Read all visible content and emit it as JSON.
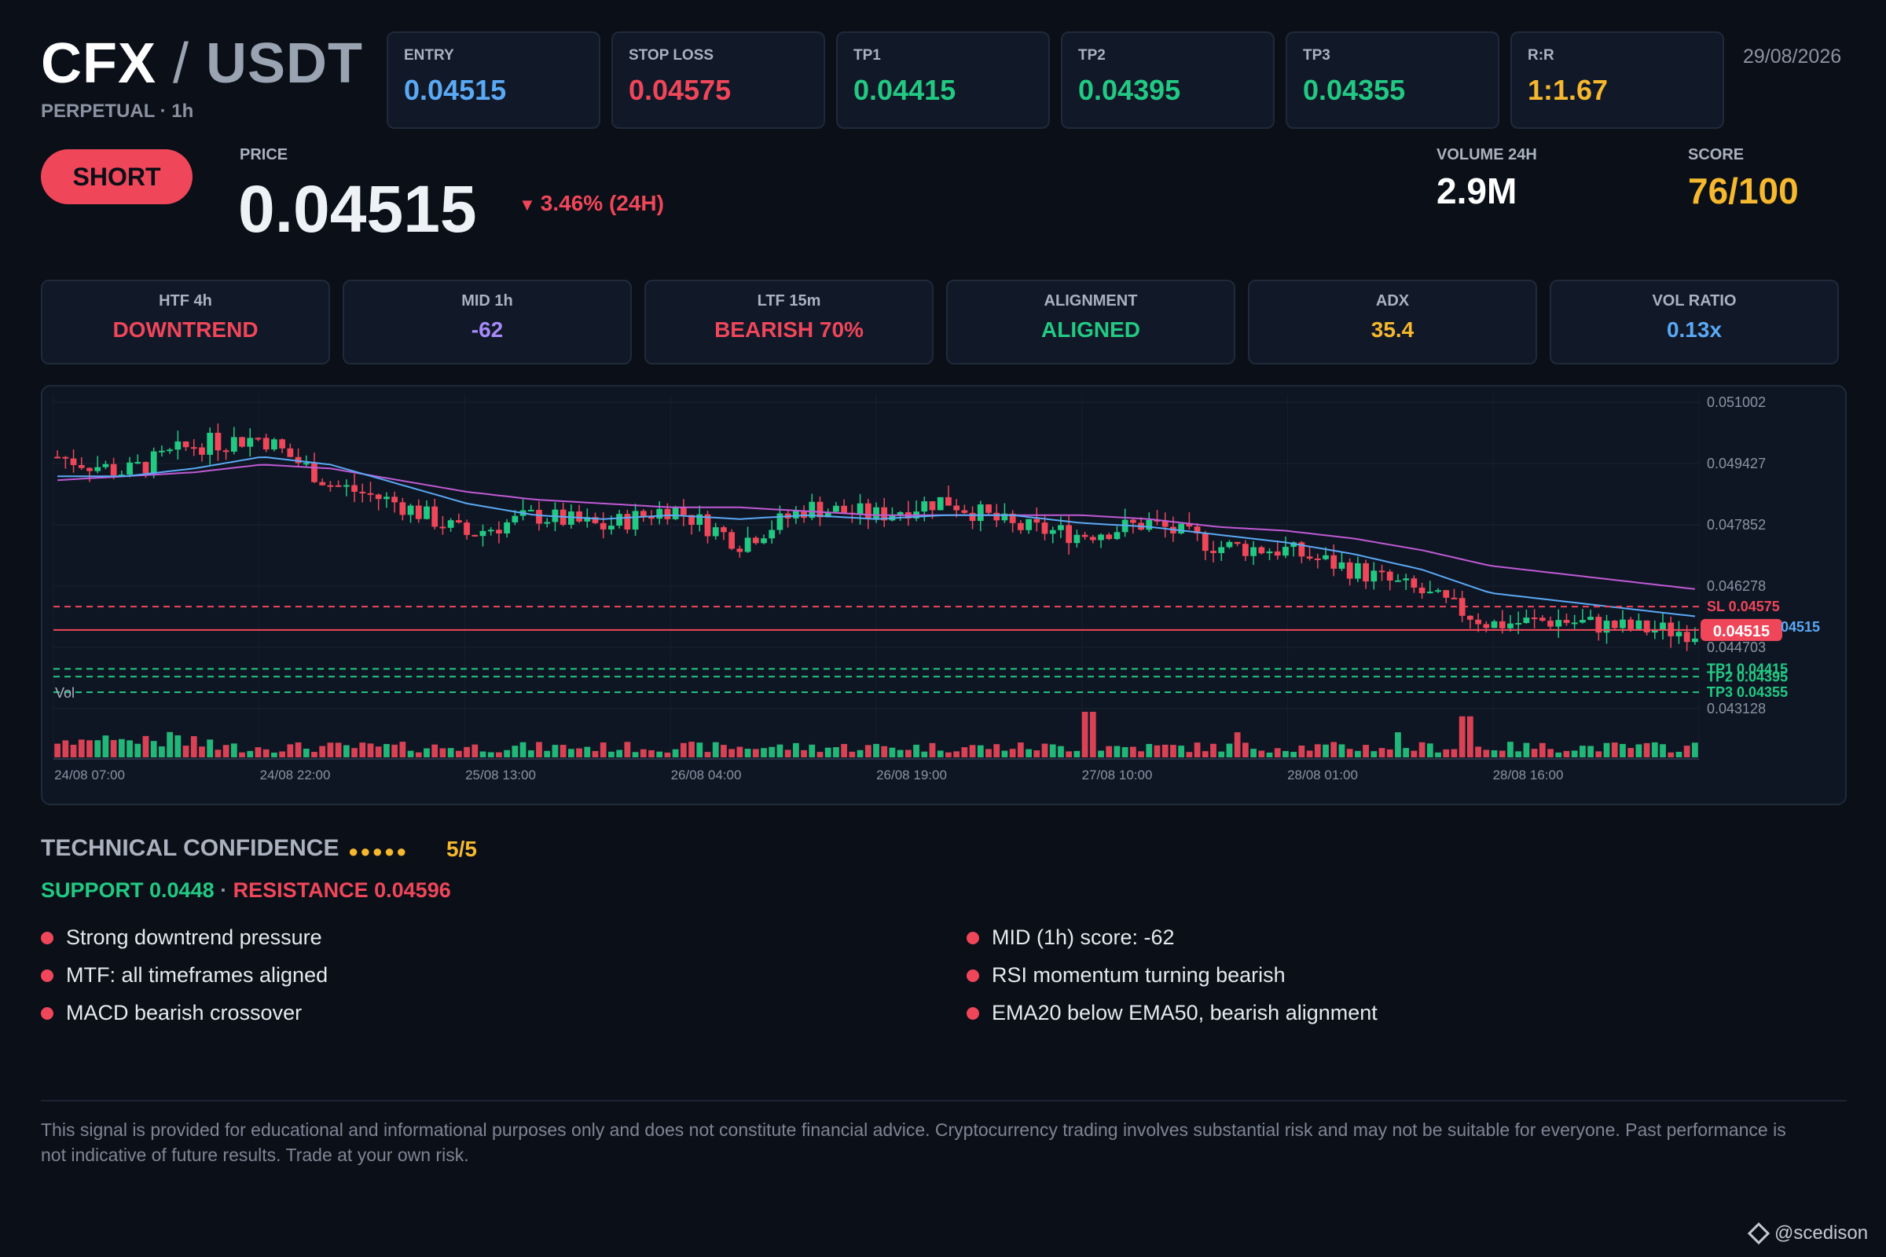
{
  "header": {
    "base": "CFX",
    "separator": " / ",
    "quote": "USDT",
    "subtitle": "PERPETUAL · 1h",
    "date": "29/08/2026"
  },
  "levels": [
    {
      "label": "ENTRY",
      "value": "0.04515",
      "color": "#5aa9f5"
    },
    {
      "label": "STOP LOSS",
      "value": "0.04575",
      "color": "#f0465a"
    },
    {
      "label": "TP1",
      "value": "0.04415",
      "color": "#22c983"
    },
    {
      "label": "TP2",
      "value": "0.04395",
      "color": "#22c983"
    },
    {
      "label": "TP3",
      "value": "0.04355",
      "color": "#22c983"
    },
    {
      "label": "R:R",
      "value": "1:1.67",
      "color": "#f5b82e"
    }
  ],
  "signal": {
    "direction": "SHORT",
    "price_label": "PRICE",
    "price": "0.04515",
    "change_arrow": "▼",
    "change": "3.46% (24H)",
    "volume_label": "VOLUME 24H",
    "volume": "2.9M",
    "score_label": "SCORE",
    "score": "76/100"
  },
  "indicators": [
    {
      "label": "HTF 4h",
      "value": "DOWNTREND",
      "color": "#f0465a"
    },
    {
      "label": "MID 1h",
      "value": "-62",
      "color": "#a78bfa"
    },
    {
      "label": "LTF 15m",
      "value": "BEARISH 70%",
      "color": "#f0465a"
    },
    {
      "label": "ALIGNMENT",
      "value": "ALIGNED",
      "color": "#22c983"
    },
    {
      "label": "ADX",
      "value": "35.4",
      "color": "#f5b82e"
    },
    {
      "label": "VOL RATIO",
      "value": "0.13x",
      "color": "#5aa9f5"
    }
  ],
  "chart_data": {
    "type": "candlestick",
    "price_ticks": [
      "0.051002",
      "0.049427",
      "0.047852",
      "0.046278",
      "0.044703",
      "0.043128"
    ],
    "ylim": [
      0.043128,
      0.051002
    ],
    "time_ticks": [
      "24/08 07:00",
      "24/08 22:00",
      "25/08 13:00",
      "26/08 04:00",
      "26/08 19:00",
      "27/08 10:00",
      "28/08 01:00",
      "28/08 16:00"
    ],
    "volume_label": "Vol",
    "lines": [
      {
        "label": "SL 0.04575",
        "value": 0.04575,
        "color": "#f0465a",
        "style": "dashed"
      },
      {
        "label": "0.04515",
        "value": 0.04515,
        "color": "#f0465a",
        "style": "solid"
      },
      {
        "label": "TP1 0.04415",
        "value": 0.04415,
        "color": "#22c983",
        "style": "dashed"
      },
      {
        "label": "TP2 0.04395",
        "value": 0.04395,
        "color": "#22c983",
        "style": "dashed"
      },
      {
        "label": "TP3 0.04355",
        "value": 0.04355,
        "color": "#22c983",
        "style": "dashed"
      }
    ],
    "entry_label": "04515",
    "close_path": [
      0.0496,
      0.0492,
      0.0499,
      0.0501,
      0.0489,
      0.0484,
      0.0476,
      0.0481,
      0.0478,
      0.0483,
      0.0474,
      0.0483,
      0.0481,
      0.0485,
      0.0478,
      0.0476,
      0.0479,
      0.0473,
      0.0472,
      0.0467,
      0.0461,
      0.0453,
      0.0454,
      0.0452,
      0.0451
    ],
    "ema20_path": [
      0.0491,
      0.0491,
      0.0493,
      0.0496,
      0.0494,
      0.0489,
      0.0484,
      0.0481,
      0.048,
      0.0481,
      0.048,
      0.0481,
      0.048,
      0.0481,
      0.0481,
      0.0479,
      0.0478,
      0.0476,
      0.0474,
      0.0471,
      0.0467,
      0.0461,
      0.0459,
      0.0457,
      0.0455
    ],
    "ema50_path": [
      0.049,
      0.0491,
      0.0492,
      0.0494,
      0.0493,
      0.049,
      0.0487,
      0.0485,
      0.0484,
      0.0483,
      0.0483,
      0.0482,
      0.0481,
      0.0481,
      0.0481,
      0.0481,
      0.048,
      0.0478,
      0.0477,
      0.0475,
      0.0472,
      0.0468,
      0.0466,
      0.0464,
      0.0462
    ],
    "volume_spikes": [
      {
        "at": 0.63,
        "height": 1.0
      },
      {
        "at": 0.86,
        "height": 0.9
      },
      {
        "at": 0.82,
        "height": 0.55
      },
      {
        "at": 0.72,
        "height": 0.55
      }
    ]
  },
  "confidence": {
    "title": "TECHNICAL CONFIDENCE",
    "dots": "●●●●●",
    "score": "5/5",
    "support": "SUPPORT 0.0448",
    "separator": " · ",
    "resistance": "RESISTANCE 0.04596"
  },
  "reasons_left": [
    "Strong downtrend pressure",
    "MTF: all timeframes aligned",
    "MACD bearish crossover"
  ],
  "reasons_right": [
    "MID (1h) score: -62",
    "RSI momentum turning bearish",
    "EMA20 below EMA50, bearish alignment"
  ],
  "disclaimer": "This signal is provided for educational and informational purposes only and does not constitute financial advice. Cryptocurrency trading involves substantial risk and may not be suitable for everyone. Past performance is not indicative of future results. Trade at your own risk.",
  "brand": "@scedison",
  "colors": {
    "bear": "#f0465a",
    "bull": "#22c983",
    "ema20": "#5aa9f5",
    "ema50": "#c05ad6",
    "accent_gold": "#f5b82e"
  }
}
